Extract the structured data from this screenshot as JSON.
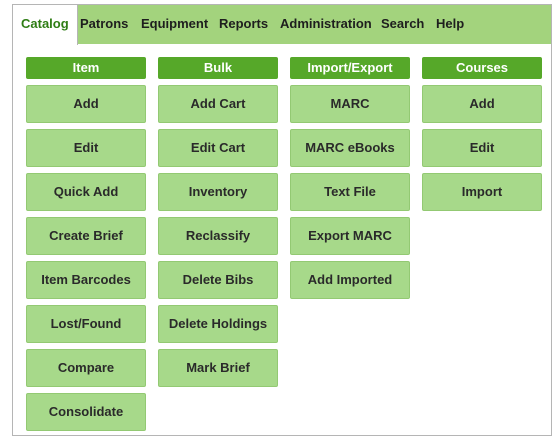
{
  "tabs": [
    {
      "label": "Catalog",
      "active": true
    },
    {
      "label": "Patrons"
    },
    {
      "label": "Equipment"
    },
    {
      "label": "Reports"
    },
    {
      "label": "Administration"
    },
    {
      "label": "Search"
    },
    {
      "label": "Help"
    }
  ],
  "columns": [
    {
      "header": "Item",
      "buttons": [
        "Add",
        "Edit",
        "Quick Add",
        "Create Brief",
        "Item Barcodes",
        "Lost/Found",
        "Compare",
        "Consolidate"
      ]
    },
    {
      "header": "Bulk",
      "buttons": [
        "Add Cart",
        "Edit Cart",
        "Inventory",
        "Reclassify",
        "Delete Bibs",
        "Delete Holdings",
        "Mark Brief"
      ]
    },
    {
      "header": "Import/Export",
      "buttons": [
        "MARC",
        "MARC eBooks",
        "Text File",
        "Export MARC",
        "Add Imported"
      ]
    },
    {
      "header": "Courses",
      "buttons": [
        "Add",
        "Edit",
        "Import"
      ]
    }
  ],
  "colors": {
    "tabbar": "#a3d37d",
    "active_tab_text": "#2e7d14",
    "column_header": "#56a829",
    "button": "#a7d98a"
  }
}
